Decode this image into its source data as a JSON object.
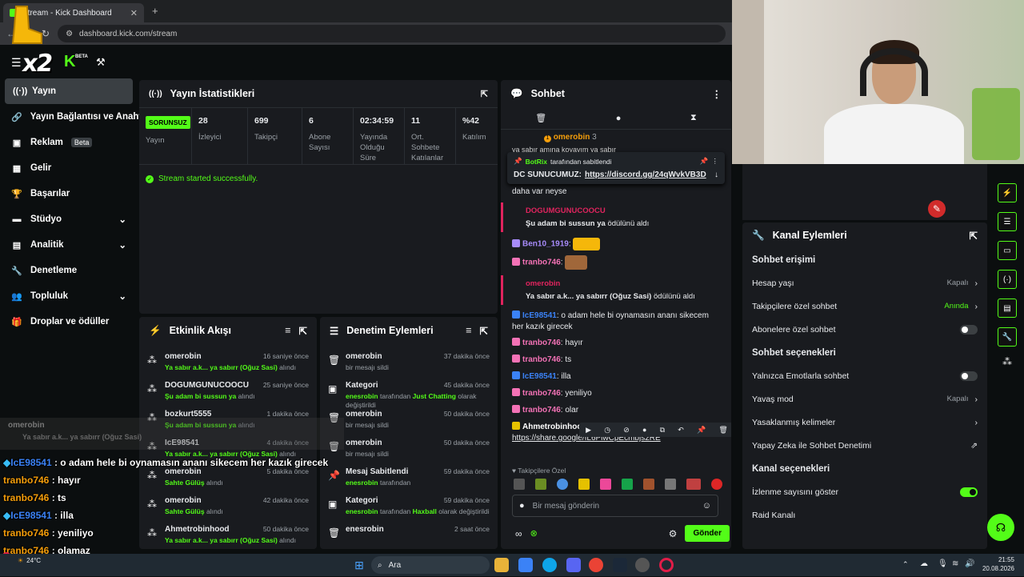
{
  "browser": {
    "tab_title": "Stream - Kick Dashboard",
    "url": "dashboard.kick.com/stream"
  },
  "brand": {
    "logo_text": "x2",
    "logo_tail": "K",
    "beta_label": "BETA"
  },
  "sidebar": {
    "items": [
      {
        "label": "Yayın",
        "icon": "broadcast-icon"
      },
      {
        "label": "Yayın Bağlantısı ve Anahta",
        "icon": "link-icon"
      },
      {
        "label": "Reklam",
        "badge": "Beta",
        "icon": "ad-icon"
      },
      {
        "label": "Gelir",
        "icon": "revenue-icon"
      },
      {
        "label": "Başarılar",
        "icon": "trophy-icon"
      },
      {
        "label": "Stüdyo",
        "icon": "studio-icon"
      },
      {
        "label": "Analitik",
        "icon": "analytics-icon"
      },
      {
        "label": "Denetleme",
        "icon": "wrench-icon"
      },
      {
        "label": "Topluluk",
        "icon": "community-icon"
      },
      {
        "label": "Droplar ve ödüller",
        "icon": "gift-icon"
      }
    ]
  },
  "stats_panel": {
    "title": "Yayın İstatistikleri",
    "live_badge": "SORUNSUZ",
    "live_label": "Yayın",
    "stats": [
      {
        "value": "28",
        "label": "İzleyici"
      },
      {
        "value": "699",
        "label": "Takipçi"
      },
      {
        "value": "6",
        "label": "Abone Sayısı"
      },
      {
        "value": "02:34:59",
        "label": "Yayında Olduğu Süre"
      },
      {
        "value": "11",
        "label": "Ort. Sohbete Katılanlar"
      },
      {
        "value": "%42",
        "label": "Katılım"
      }
    ],
    "success_msg": "Stream started successfully."
  },
  "activity_panel": {
    "title": "Etkinlik Akışı",
    "items": [
      {
        "name": "omerobin",
        "time": "16 saniye önce",
        "reward": "Ya sabır a.k... ya sabırr (Oğuz Sasi)",
        "suffix": "alındı"
      },
      {
        "name": "DOGUMGUNUCOOCU",
        "time": "25 saniye önce",
        "reward": "Şu adam bi sussun ya",
        "suffix": "alındı"
      },
      {
        "name": "bozkurt5555",
        "time": "1 dakika önce",
        "reward": "Şu adam bi sussun ya",
        "suffix": "alındı"
      },
      {
        "name": "IcE98541",
        "time": "4 dakika önce",
        "reward": "Ya sabır a.k... ya sabırr (Oğuz Sasi)",
        "suffix": "alındı"
      },
      {
        "name": "omerobin",
        "time": "5 dakika önce",
        "reward": "Sahte Gülüş",
        "suffix": "alındı"
      },
      {
        "name": "omerobin",
        "time": "42 dakika önce",
        "reward": "Sahte Gülüş",
        "suffix": "alındı"
      },
      {
        "name": "Ahmetrobinhood",
        "time": "50 dakika önce",
        "reward": "Ya sabır a.k... ya sabırr (Oğuz Sasi)",
        "suffix": "alındı"
      }
    ]
  },
  "mod_panel": {
    "title": "Denetim Eylemleri",
    "items": [
      {
        "name": "omerobin",
        "time": "37 dakika önce",
        "detail": "bir mesajı sildi",
        "icon": "trash-icon"
      },
      {
        "name": "Kategori",
        "time": "45 dakika önce",
        "actor": "enesrobin",
        "detail_pre": "tarafından",
        "detail_hl": "Just Chatting",
        "detail_post": "olarak değiştirildi",
        "icon": "category-icon"
      },
      {
        "name": "omerobin",
        "time": "50 dakika önce",
        "detail": "bir mesajı sildi",
        "icon": "trash-icon"
      },
      {
        "name": "omerobin",
        "time": "50 dakika önce",
        "detail": "bir mesajı sildi",
        "icon": "trash-icon"
      },
      {
        "name": "Mesaj Sabitlendi",
        "time": "59 dakika önce",
        "actor": "enesrobin",
        "detail": "tarafından",
        "icon": "pin-icon"
      },
      {
        "name": "Kategori",
        "time": "59 dakika önce",
        "actor": "enesrobin",
        "detail_pre": "tarafından",
        "detail_hl": "Haxball",
        "detail_post": "olarak değiştirildi",
        "icon": "category-icon"
      },
      {
        "name": "enesrobin",
        "time": "2 saat önce",
        "icon": "trash-icon"
      }
    ]
  },
  "chat": {
    "title": "Sohbet",
    "top_user": "omerobin",
    "top_user_count": "3",
    "clipped_line": "ya sabır amına koyayım ya sabır",
    "pinned_by": "BotRix",
    "pinned_suffix": "tarafından sabitlendi",
    "pinned_label": "DC SUNUCUMUZ:",
    "pinned_link": "https://discord.gg/24qWvkVB3D",
    "clipped_text": "daha var neyse",
    "messages": [
      {
        "type": "gift",
        "user": "DOGUMGUNUCOOCU",
        "text": "Şu adam bi sussun ya",
        "suffix": "ödülünü aldı",
        "color": "#e0245e"
      },
      {
        "type": "msg",
        "user": "Ben10_1919",
        "text": "",
        "color": "#a78bfa",
        "emote": "feet"
      },
      {
        "type": "msg",
        "user": "tranbo746",
        "text": "",
        "color": "#f472b6",
        "emote": "face"
      },
      {
        "type": "gift",
        "user": "omerobin",
        "text": "Ya sabır a.k... ya sabırr (Oğuz Sasi)",
        "suffix": "ödülünü aldı",
        "color": "#e0245e"
      },
      {
        "type": "msg",
        "user": "IcE98541",
        "text": "o adam hele bi oynamasın ananı sikecem her kazık girecek",
        "color": "#3b82f6"
      },
      {
        "type": "msg",
        "user": "tranbo746",
        "text": "hayır",
        "color": "#f472b6"
      },
      {
        "type": "msg",
        "user": "tranbo746",
        "text": "ts",
        "color": "#f472b6"
      },
      {
        "type": "msg",
        "user": "IcE98541",
        "text": "illa",
        "color": "#3b82f6"
      },
      {
        "type": "msg",
        "user": "tranbo746",
        "text": "yeniliyo",
        "color": "#f472b6"
      },
      {
        "type": "msg",
        "user": "tranbo746",
        "text": "olar",
        "color": "#f472b6"
      },
      {
        "type": "msg",
        "user": "Ahmetrobinhood",
        "text": "https://share.google/IL6PlwCpEcmbjs2RE",
        "color": "#ffffff",
        "link": true
      }
    ],
    "followers_only": "Takipçilere Özel",
    "input_placeholder": "Bir mesaj gönderin",
    "send_label": "Gönder"
  },
  "channel_actions": {
    "title": "Kanal Eylemleri",
    "section1": "Sohbet erişimi",
    "rows1": [
      {
        "label": "Hesap yaşı",
        "value": "Kapalı",
        "kind": "chevron"
      },
      {
        "label": "Takipçilere özel sohbet",
        "value": "Anında",
        "kind": "chevron",
        "green": true
      },
      {
        "label": "Abonelere özel sohbet",
        "kind": "toggle",
        "on": false
      }
    ],
    "section2": "Sohbet seçenekleri",
    "rows2": [
      {
        "label": "Yalnızca Emotlarla sohbet",
        "kind": "toggle",
        "on": false
      },
      {
        "label": "Yavaş mod",
        "value": "Kapalı",
        "kind": "chevron"
      },
      {
        "label": "Yasaklanmış kelimeler",
        "kind": "chevron"
      },
      {
        "label": "Yapay Zeka ile Sohbet Denetimi",
        "kind": "external"
      }
    ],
    "section3": "Kanal seçenekleri",
    "rows3": [
      {
        "label": "İzlenme sayısını göster",
        "kind": "toggle",
        "on": true
      },
      {
        "label": "Raid Kanalı",
        "kind": "none"
      }
    ]
  },
  "overlay_chat": [
    {
      "user": "IcE98541",
      "text": "o adam hele bi oynamasın ananı sikecem her kazık girecek",
      "color": "#3b82f6",
      "badge": true
    },
    {
      "user": "tranbo746",
      "text": "hayır",
      "color": "#f59e0b"
    },
    {
      "user": "tranbo746",
      "text": "ts",
      "color": "#f59e0b"
    },
    {
      "user": "IcE98541",
      "text": "illa",
      "color": "#3b82f6",
      "badge": true
    },
    {
      "user": "tranbo746",
      "text": "yeniliyo",
      "color": "#f59e0b"
    },
    {
      "user": "tranbo746",
      "text": "olamaz",
      "color": "#f59e0b"
    },
    {
      "user": "Ahmetrobinhood",
      "text": "https://share.google/IL6PlwCpEcmbjs2RE",
      "color": "#ffffff",
      "text_color": "#a78bfa"
    }
  ],
  "overlay_ghost": {
    "user": "omerobin",
    "text": "Ya sabır a.k... ya sabırr (Oğuz Sasi)"
  },
  "taskbar": {
    "search": "Ara",
    "weather": "24°C",
    "time": "21:55",
    "date": "20.08.2026"
  }
}
